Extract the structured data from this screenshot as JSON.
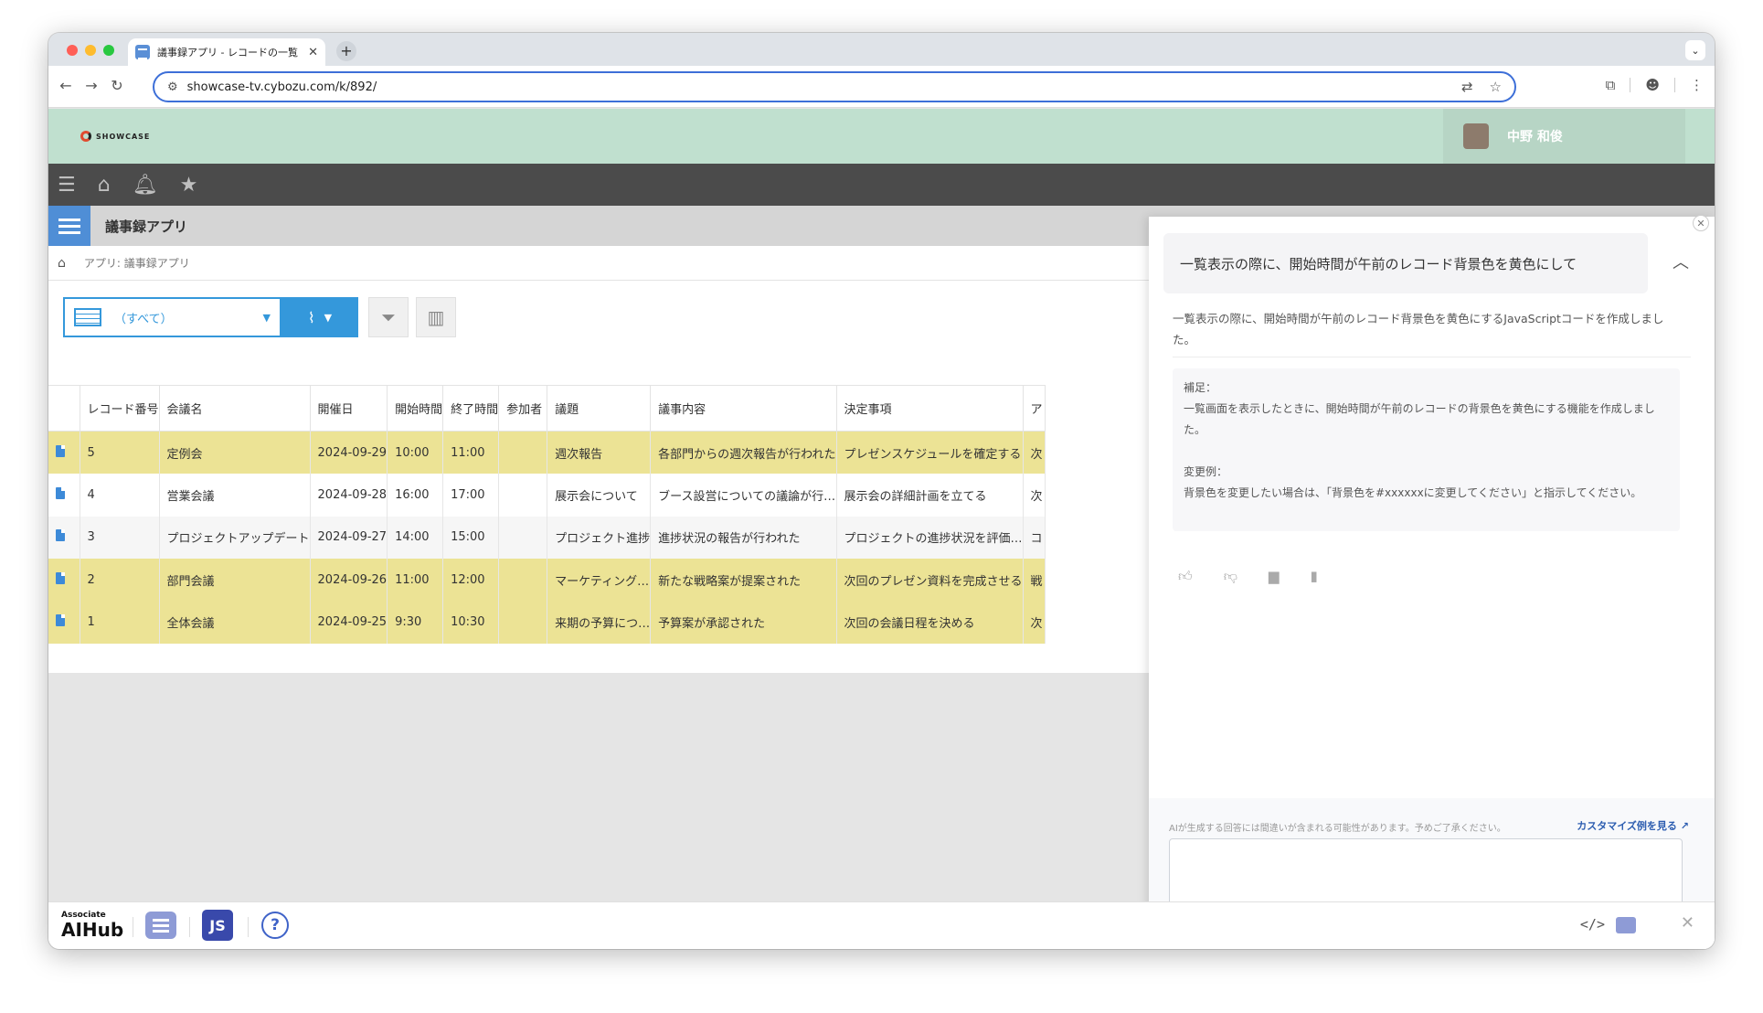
{
  "browser": {
    "tab_title": "議事録アプリ - レコードの一覧",
    "tab_close": "✕",
    "new_tab": "+",
    "url": "showcase-tv.cybozu.com/k/892/"
  },
  "header": {
    "logo_text": "SHOWCASE",
    "user_name": "中野 和俊"
  },
  "app": {
    "title": "議事録アプリ",
    "breadcrumb": "アプリ: 議事録アプリ",
    "view_label": "（すべて）"
  },
  "table": {
    "columns": [
      "レコード番号",
      "会議名",
      "開催日",
      "開始時間",
      "終了時間",
      "参加者",
      "議題",
      "議事内容",
      "決定事項",
      "ア"
    ],
    "rows": [
      {
        "no": "5",
        "name": "定例会",
        "date": "2024-09-29",
        "start": "10:00",
        "end": "11:00",
        "attendees": "",
        "topic": "週次報告",
        "content": "各部門からの週次報告が行われた",
        "decision": "プレゼンスケジュールを確定する",
        "extra": "次"
      },
      {
        "no": "4",
        "name": "営業会議",
        "date": "2024-09-28",
        "start": "16:00",
        "end": "17:00",
        "attendees": "",
        "topic": "展示会について",
        "content": "ブース設営についての議論が行…",
        "decision": "展示会の詳細計画を立てる",
        "extra": "次"
      },
      {
        "no": "3",
        "name": "プロジェクトアップデート",
        "date": "2024-09-27",
        "start": "14:00",
        "end": "15:00",
        "attendees": "",
        "topic": "プロジェクト進捗",
        "content": "進捗状況の報告が行われた",
        "decision": "プロジェクトの進捗状況を評価…",
        "extra": "コ"
      },
      {
        "no": "2",
        "name": "部門会議",
        "date": "2024-09-26",
        "start": "11:00",
        "end": "12:00",
        "attendees": "",
        "topic": "マーケティング…",
        "content": "新たな戦略案が提案された",
        "decision": "次回のプレゼン資料を完成させる",
        "extra": "戦"
      },
      {
        "no": "1",
        "name": "全体会議",
        "date": "2024-09-25",
        "start": "9:30",
        "end": "10:30",
        "attendees": "",
        "topic": "来期の予算につ…",
        "content": "予算案が承認された",
        "decision": "次回の会議日程を決める",
        "extra": "次"
      }
    ]
  },
  "ai_panel": {
    "prompt": "一覧表示の際に、開始時間が午前のレコード背景色を黄色にして",
    "answer": "一覧表示の際に、開始時間が午前のレコード背景色を黄色にするJavaScriptコードを作成しました。",
    "note_title": "補足：",
    "note_body": "一覧画面を表示したときに、開始時間が午前のレコードの背景色を黄色にする機能を作成しました。",
    "change_title": "変更例：",
    "change_body": "背景色を変更したい場合は、「背景色を#xxxxxxに変更してください」と指示してください。",
    "disclaimer": "AIが生成する回答には間違いが含まれる可能性があります。予めご了承ください。",
    "custom_link": "カスタマイズ例を見る",
    "input_value": "",
    "input_placeholder": ""
  },
  "bottom_bar": {
    "brand_small": "Associate",
    "brand_big": "AIHub",
    "js_label": "JS",
    "help_label": "?",
    "code_label": "</>"
  },
  "colors": {
    "highlight_row": "#ece395",
    "accent": "#3498db",
    "brand_bg": "#c0e0cf"
  }
}
